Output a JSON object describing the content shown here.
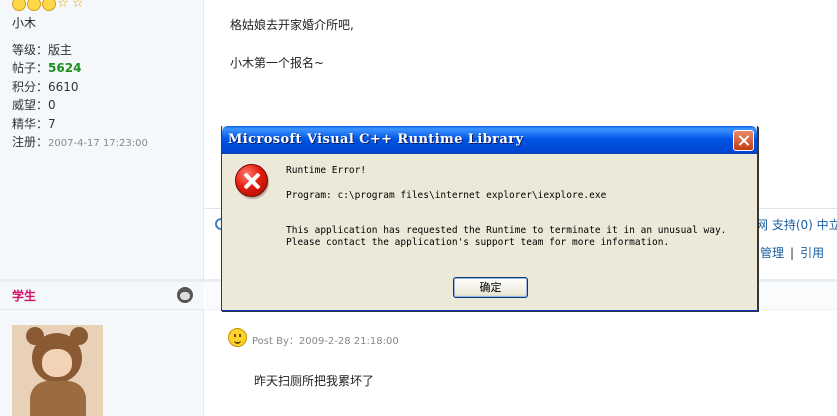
{
  "forum": {
    "post1": {
      "username": "小木",
      "stats": [
        {
          "key": "等级：",
          "value": "版主"
        },
        {
          "key": "帖子：",
          "value": "5624"
        },
        {
          "key": "积分：",
          "value": "6610"
        },
        {
          "key": "威望：",
          "value": "0"
        },
        {
          "key": "精华：",
          "value": "7"
        },
        {
          "key": "注册：",
          "value": "2007-4-17 17:23:00"
        }
      ],
      "line1": "格姑娘去开家婚介所吧,",
      "line2": "小木第一个报名~",
      "links_right": "网 支持(0) 中立",
      "manage": "管理",
      "quote": "引用",
      "link_separator": "|"
    },
    "post2": {
      "role": "学生",
      "post_by": "Post By：2009-2-28 21:18:00",
      "message": "昨天扫厕所把我累坏了"
    }
  },
  "dialog": {
    "title": "Microsoft Visual C++ Runtime Library",
    "error_heading": "Runtime Error!",
    "program_line": "Program: c:\\program files\\internet explorer\\iexplore.exe",
    "message_line1": "This application has requested the Runtime to terminate it in an unusual way.",
    "message_line2": "Please contact the application's support team for more information.",
    "ok_label": "确定"
  }
}
